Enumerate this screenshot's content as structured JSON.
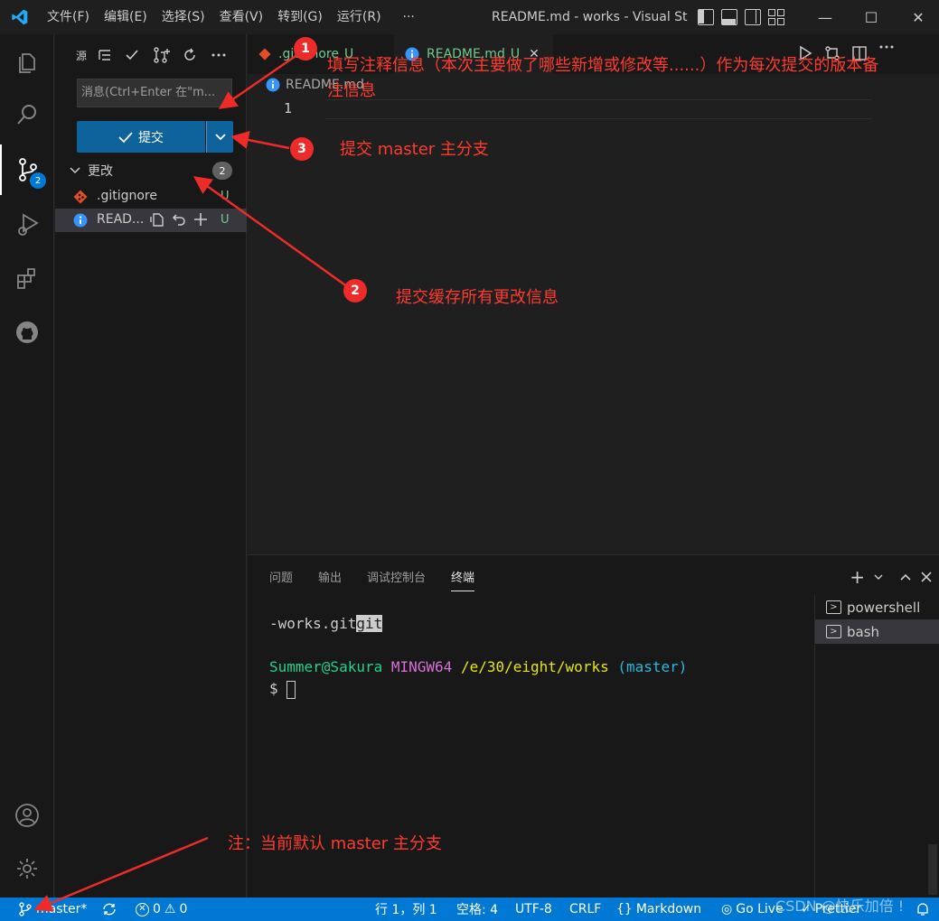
{
  "titlebar": {
    "menu": [
      "文件(F)",
      "编辑(E)",
      "选择(S)",
      "查看(V)",
      "转到(G)",
      "运行(R)",
      "···"
    ],
    "window_title": "README.md - works - Visual St...",
    "minimize": "—",
    "maximize": "☐",
    "close": "✕"
  },
  "activity": {
    "scm_badge": "2"
  },
  "sidebar": {
    "toolbar_first": "源",
    "message_placeholder": "消息(Ctrl+Enter 在\"m...",
    "commit_label": "提交",
    "changes_title": "更改",
    "changes_count": "2",
    "files": [
      {
        "name": ".gitignore",
        "status": "U"
      },
      {
        "name": "READ...",
        "status": "U"
      }
    ]
  },
  "editor": {
    "tabs": [
      {
        "label": ".gitignore",
        "status": "U"
      },
      {
        "label": "README.md",
        "status": "U",
        "close": "✕"
      }
    ],
    "breadcrumb": "README.md",
    "line_number": "1"
  },
  "panel": {
    "tabs": [
      "问题",
      "输出",
      "调试控制台",
      "终端"
    ],
    "terminal_lines": {
      "line1_prefix": "-works.git",
      "line1_highlight": "git",
      "user_host": "Summer@Sakura",
      "mingw": "MINGW64",
      "path": "/e/30/eight/works",
      "branch": "(master)",
      "prompt": "$"
    },
    "terminals": [
      "powershell",
      "bash"
    ]
  },
  "statusbar": {
    "branch": "master*",
    "errors": "0",
    "warnings": "0",
    "position": "行 1，列 1",
    "spaces": "空格: 4",
    "encoding": "UTF-8",
    "eol": "CRLF",
    "language": "Markdown",
    "golive": "Go Live",
    "prettier": "Prettier"
  },
  "annotations": {
    "a1_num": "1",
    "a1_text_line1": "填写注释信息（本次主要做了哪些新增或修改等......）作为每次提交的版本备",
    "a1_text_line2": "注信息",
    "a2_num": "2",
    "a2_text": "提交缓存所有更改信息",
    "a3_num": "3",
    "a3_text": "提交 master 主分支",
    "note": "注：当前默认 master 主分支",
    "watermark": "CSDN @快乐加倍 !"
  },
  "colors": {
    "accent": "#0078d4",
    "commit_button": "#0e639c",
    "annotation": "#ff3b30",
    "untracked": "#73c991"
  }
}
